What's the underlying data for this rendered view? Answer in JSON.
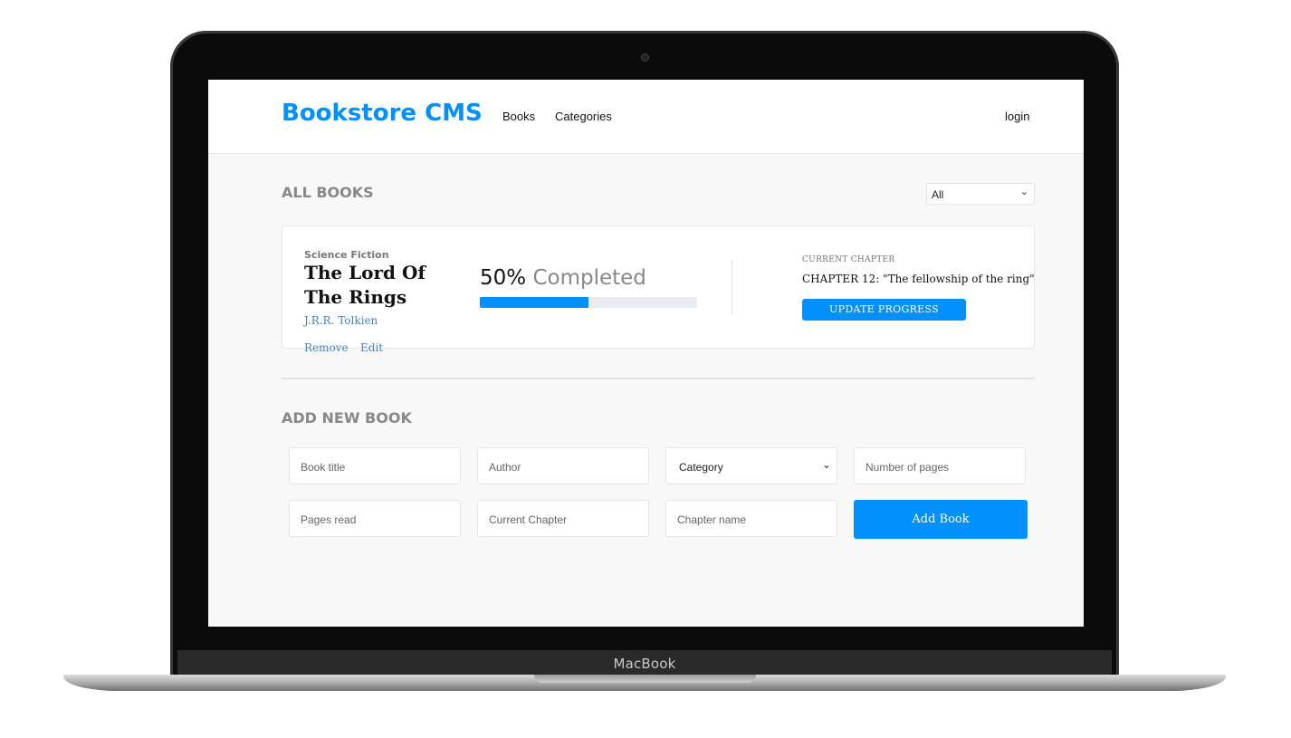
{
  "device": {
    "brand_label": "MacBook"
  },
  "header": {
    "logo": "Bookstore CMS",
    "nav": [
      "Books",
      "Categories"
    ],
    "login": "login"
  },
  "books_section": {
    "title": "ALL BOOKS",
    "filter": {
      "selected": "All",
      "chevron": "⌄"
    }
  },
  "book": {
    "genre": "Science Fiction",
    "title": "The Lord Of The Rings",
    "author": "J.R.R. Tolkien",
    "actions": [
      "Remove",
      "Edit"
    ],
    "progress_percent": "50%",
    "progress_value": 0.5,
    "progress_label": "Completed",
    "current_chapter_label": "CURRENT CHAPTER",
    "current_chapter": "CHAPTER 12: \"The fellowship of the ring\"",
    "update_button": "UPDATE PROGRESS"
  },
  "add_section": {
    "title": "ADD NEW BOOK",
    "fields": {
      "book_title": "Book title",
      "author": "Author",
      "category": "Category",
      "pages": "Number of pages",
      "pages_read": "Pages read",
      "current_chapter": "Current Chapter",
      "chapter_name": "Chapter name"
    },
    "submit": "Add Book"
  },
  "colors": {
    "accent": "#0290ff",
    "link": "#4386bf",
    "text": "#121212"
  }
}
